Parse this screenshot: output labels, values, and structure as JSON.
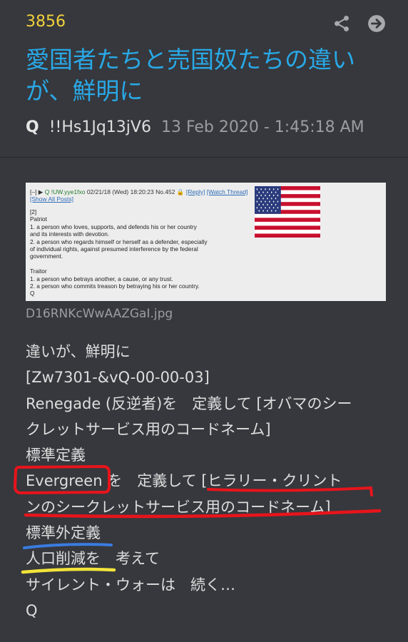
{
  "post": {
    "number": "3856",
    "title": "愛国者たちと売国奴たちの違いが、鮮明に",
    "author": "Q",
    "tripcode": "!!Hs1Jq13jV6",
    "date": "13 Feb 2020 - 1:45:18 AM"
  },
  "header_icons": [
    "share-icon",
    "arrow-right-circle-icon"
  ],
  "attachment": {
    "filename": "D16RNKcWwAAZGaI.jpg",
    "header": {
      "name": "Q",
      "trip": "!UW.yye1fxo",
      "datetime": "02/21/18 (Wed) 18:20:23",
      "no": "No.452",
      "reply": "[Reply]",
      "watch": "[Watch Thread]",
      "show_all": "[Show All Posts]"
    },
    "lines": [
      "[2]",
      "Patriot",
      "1. a person who loves, supports, and defends his or her country",
      "and its interests with devotion.",
      "2. a person who regards himself or herself as a defender, especially",
      "of individual rights, against presumed interference by the federal",
      "government.",
      "",
      "Traitor",
      "1. a person who betrays another, a cause, or any trust.",
      "2. a person who commits treason by betraying his or her country.",
      "Q"
    ]
  },
  "body_lines": [
    "違いが、鮮明に",
    "[Zw7301-&vQ-00-00-03]",
    "Renegade (反逆者)を　定義して [オバマのシー",
    "クレットサービス用のコードネーム]",
    "標準定義",
    "Evergreen を　定義して [ヒラリー・クリント",
    "ンのシークレットサービス用のコードネーム]",
    "標準外定義",
    "人口削減を　考えて",
    "サイレント・ウォーは　続く…",
    "Q"
  ],
  "annotation_colors": {
    "red": "#e8141c",
    "blue": "#3a7be0",
    "yellow": "#f2e33a"
  }
}
